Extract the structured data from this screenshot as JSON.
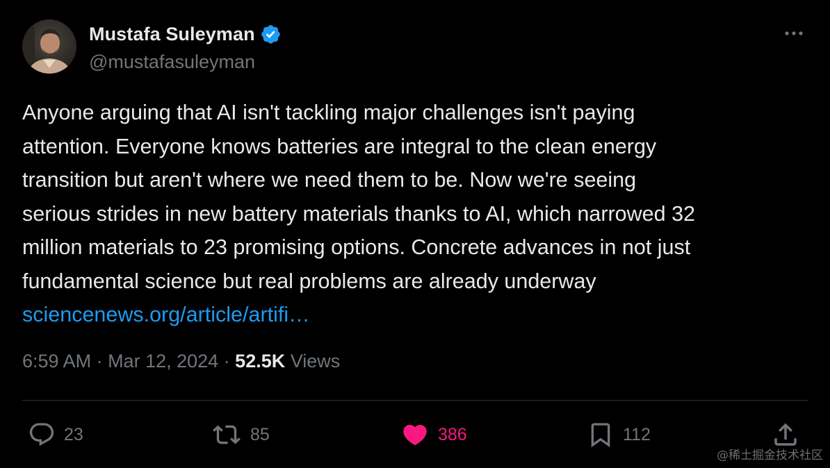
{
  "author": {
    "display_name": "Mustafa Suleyman",
    "handle": "@mustafasuleyman",
    "verified": true
  },
  "tweet": {
    "lines": [
      "Anyone arguing that AI isn't tackling major challenges isn't paying",
      "attention. Everyone knows batteries are integral to the clean energy",
      "transition but aren't where we need them to be. Now we're seeing",
      "serious strides in new battery materials thanks to AI, which narrowed 32",
      "million materials to 23 promising options. Concrete advances in not just",
      "fundamental science but real problems are already underway"
    ],
    "link_text": "sciencenews.org/article/artifi…"
  },
  "meta": {
    "time": "6:59 AM",
    "separator": " · ",
    "date": "Mar 12, 2024",
    "views_count": "52.5K",
    "views_label": " Views"
  },
  "actions": {
    "replies": "23",
    "reposts": "85",
    "likes": "386",
    "bookmarks": "112"
  },
  "watermark": "@稀土掘金技术社区",
  "colors": {
    "background": "#000000",
    "text": "#e7e9ea",
    "secondary": "#71767b",
    "link": "#1d9bf0",
    "like": "#f91880",
    "verified": "#1d9bf0",
    "divider": "#2f3336"
  },
  "icons": {
    "verified": "verified-badge-icon",
    "more": "more-dots-icon",
    "reply": "reply-bubble-icon",
    "repost": "repost-arrows-icon",
    "like": "heart-filled-icon",
    "bookmark": "bookmark-icon",
    "share": "share-upload-icon"
  }
}
